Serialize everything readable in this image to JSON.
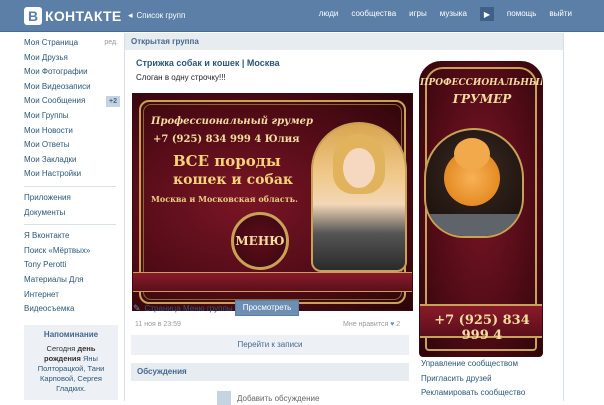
{
  "header": {
    "logo_letter": "В",
    "logo_text": "КОНТАКТЕ",
    "back_label": "Список групп",
    "nav": [
      "люди",
      "сообщества",
      "игры",
      "музыка",
      "помощь",
      "выйти"
    ]
  },
  "sidebar": {
    "items": [
      {
        "label": "Моя Страница",
        "suffix": "ред."
      },
      {
        "label": "Мои Друзья"
      },
      {
        "label": "Мои Фотографии"
      },
      {
        "label": "Мои Видеозаписи"
      },
      {
        "label": "Мои Сообщения",
        "badge": "+2"
      },
      {
        "label": "Мои Группы"
      },
      {
        "label": "Мои Новости"
      },
      {
        "label": "Мои Ответы"
      },
      {
        "label": "Мои Закладки"
      },
      {
        "label": "Мои Настройки"
      }
    ],
    "apps": [
      "Приложения",
      "Документы"
    ],
    "extra": [
      "Я Вконтакте",
      "Поиск «Мёртвых»",
      "Tony Perotti",
      "Материалы Для",
      "Интернет",
      "Видеосъемка"
    ]
  },
  "reminder": {
    "title": "Напоминание",
    "text_before": "Сегодня ",
    "bold": "день рождения",
    "text_names": " Яны Полторацкой, Тани Карповой, Сергея Гладких."
  },
  "group": {
    "type_label": "Открытая группа",
    "name": "Стрижка собак и кошек | Москва",
    "slogan": "Слоган в одну строчку!!!"
  },
  "banner": {
    "title": "Профессиональный грумер",
    "phone": "+7 (925) 834 999 4 Юлия",
    "line1": "ВСЕ породы",
    "line2": "кошек и собак",
    "city": "Москва и Московская область.",
    "menu": "МЕНЮ"
  },
  "vbanner": {
    "title1": "ПРОФЕССИОНАЛЬНЫЙ",
    "title2": "ГРУМЕР",
    "phone": "+7 (925) 834 999 4"
  },
  "post": {
    "page_link": "Страница Меню группы",
    "view_button": "Просмотреть",
    "date": "11 ноя в 23:59",
    "likes_label": "Мне нравится",
    "likes_count": "2",
    "to_posts": "Перейти к записи",
    "discussions": "Обсуждения",
    "add_discussion": "Добавить обсуждение"
  },
  "right_links": [
    "Управление сообществом",
    "Пригласить друзей",
    "Рекламировать сообщество"
  ],
  "colors": {
    "header": "#5b7fa6",
    "link": "#2b587a",
    "banner": "#5c0e1a",
    "gold": "#c9a157"
  }
}
